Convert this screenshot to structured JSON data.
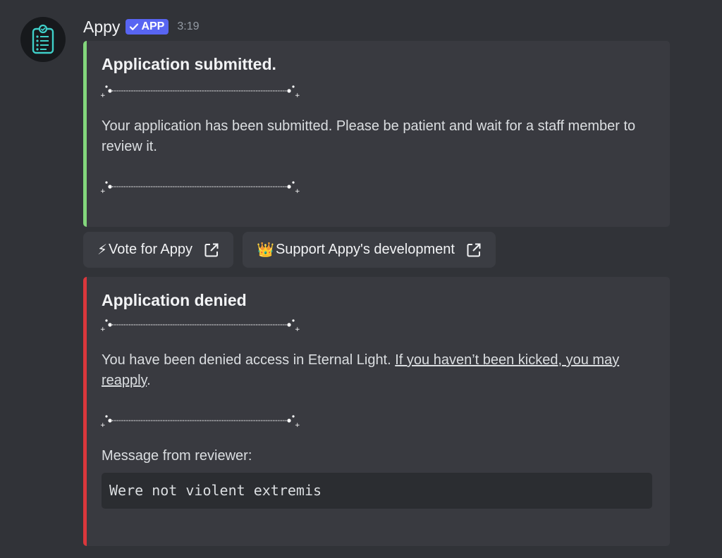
{
  "message": {
    "author": "Appy",
    "badge": "APP",
    "timestamp": "3:19"
  },
  "embed_submitted": {
    "title": "Application submitted.",
    "body": "Your application has been submitted. Please be patient and wait for a staff member to review it.",
    "accent_color": "#83d67c"
  },
  "buttons": [
    {
      "emoji": "⚡",
      "label": "Vote for Appy",
      "icon": "external-link-icon"
    },
    {
      "emoji": "👑",
      "label": "Support Appy's development",
      "icon": "external-link-icon"
    }
  ],
  "embed_denied": {
    "title": "Application denied",
    "body_prefix": "You have been denied access in Eternal Light. ",
    "link_text": "If you haven’t been kicked, you may reapply",
    "body_suffix": ".",
    "reviewer_label": "Message from reviewer:",
    "reviewer_message": "Were not violent extremis",
    "accent_color": "#da373c"
  },
  "icons": {
    "avatar": "clipboard-checklist-icon",
    "badge": "checkmark-icon",
    "divider": "sparkle-divider-icon"
  }
}
